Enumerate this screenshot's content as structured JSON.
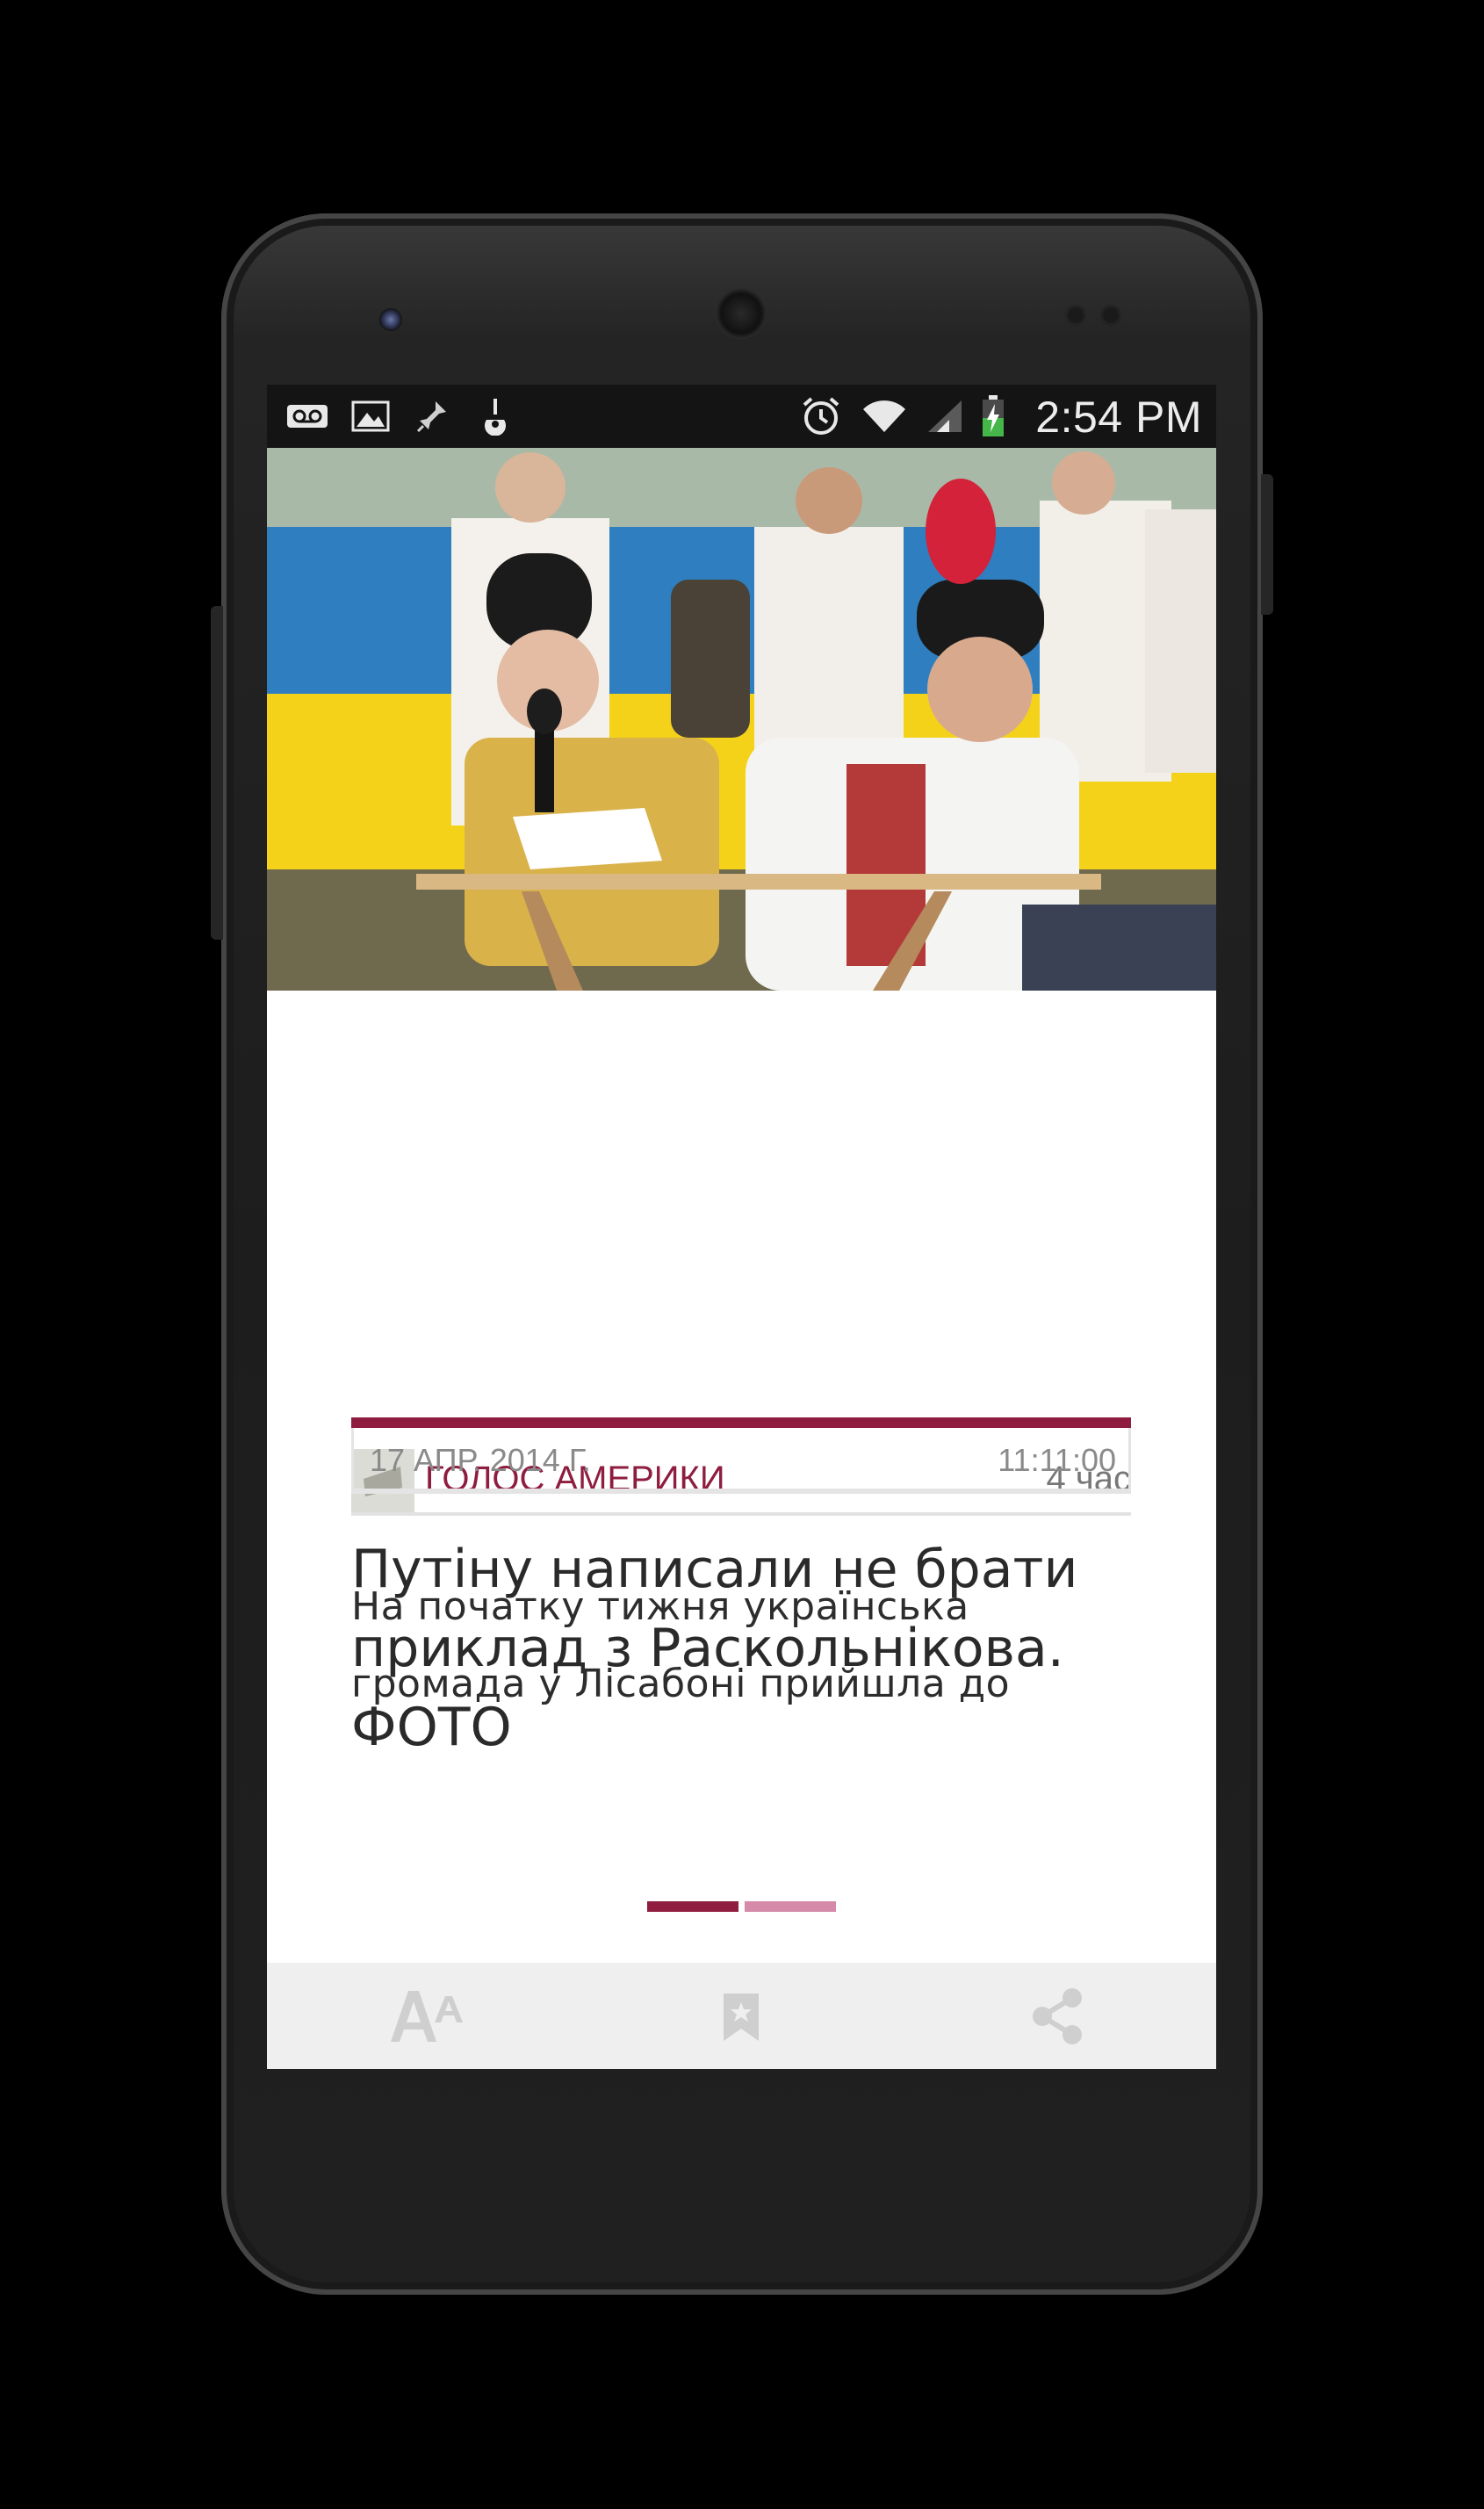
{
  "status_bar": {
    "time": "2:54 PM",
    "icons": [
      "voicemail-icon",
      "image-icon",
      "pin-icon",
      "download-icon",
      "alarm-icon",
      "wifi-icon",
      "signal-icon",
      "battery-charging-icon"
    ]
  },
  "article": {
    "source_name": "ГОЛОС АМЕРИКИ",
    "age": "4 час",
    "title": "Путіну написали не брати приклад з Раскольнікова. ФОТО",
    "date": "17 АПР. 2014 Г.",
    "time": "11:11:00",
    "body": "На початку тижня українська громада у Лісабоні прийшла до"
  },
  "pager": {
    "count": 2,
    "active_index": 0
  },
  "toolbar": {
    "items": [
      "font-size-icon",
      "bookmark-icon",
      "share-icon"
    ]
  },
  "colors": {
    "accent": "#8e1d3f",
    "accent_light": "#d48aa8",
    "toolbar_icon": "#cfcfcf"
  }
}
